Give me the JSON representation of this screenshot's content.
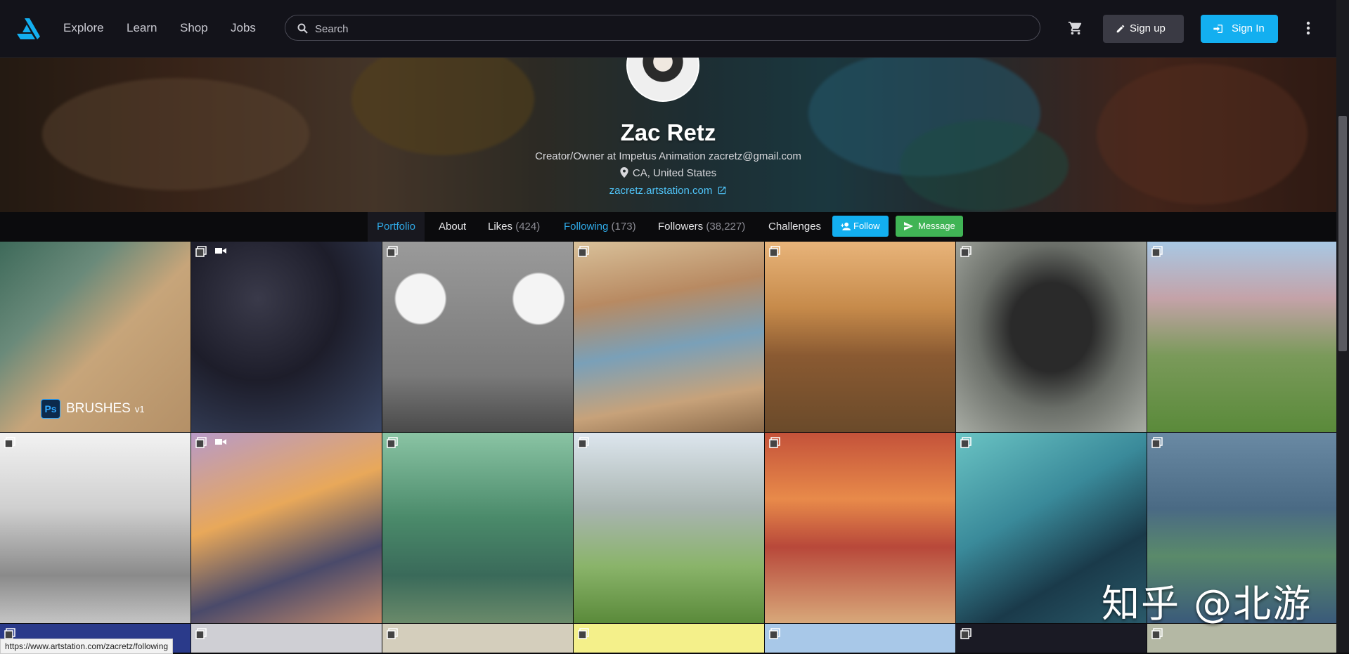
{
  "nav": {
    "logo": "artstation-logo",
    "links": [
      "Explore",
      "Learn",
      "Shop",
      "Jobs"
    ]
  },
  "search": {
    "placeholder": "Search"
  },
  "header_buttons": {
    "signup": "Sign up",
    "signin": "Sign In"
  },
  "profile": {
    "name": "Zac Retz",
    "headline": "Creator/Owner at Impetus Animation zacretz@gmail.com",
    "location": "CA, United States",
    "website": "zacretz.artstation.com"
  },
  "tabs": [
    {
      "label": "Portfolio",
      "count": ""
    },
    {
      "label": "About",
      "count": ""
    },
    {
      "label": "Likes",
      "count": "(424)"
    },
    {
      "label": "Following",
      "count": "(173)"
    },
    {
      "label": "Followers",
      "count": "(38,227)"
    },
    {
      "label": "Challenges",
      "count": ""
    }
  ],
  "actions": {
    "follow": "Follow",
    "message": "Message"
  },
  "brushes_tile": {
    "badge": "Ps",
    "label": "BRUSHES",
    "version": "v1"
  },
  "watermark": "知乎 @北游",
  "status_url": "https://www.artstation.com/zacretz/following",
  "colors": {
    "accent": "#13aff0",
    "message_green": "#40b455",
    "topbar": "#13131a"
  }
}
